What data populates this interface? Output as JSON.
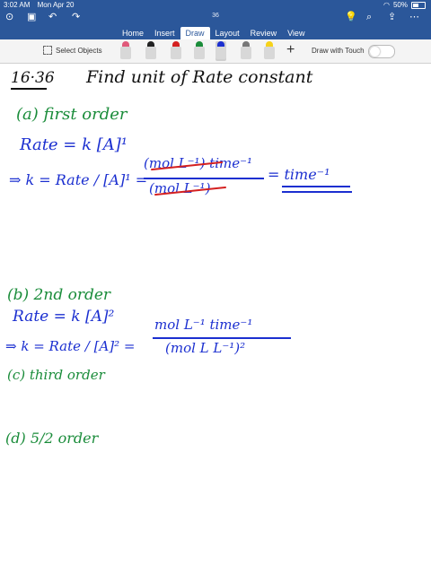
{
  "status_bar": {
    "time": "3:02 AM",
    "date": "Mon Apr 20",
    "battery": "50%",
    "battery_level": 0.5
  },
  "doc": {
    "title": "36"
  },
  "tabs": [
    "Home",
    "Insert",
    "Draw",
    "Layout",
    "Review",
    "View"
  ],
  "active_tab": "Draw",
  "toolbar": {
    "select_objects": "Select Objects",
    "draw_with_touch": "Draw with Touch",
    "pens": [
      {
        "name": "pen-pink",
        "color": "#e05a7a"
      },
      {
        "name": "pen-dark",
        "color": "#222222"
      },
      {
        "name": "pen-red",
        "color": "#d42020"
      },
      {
        "name": "pen-green",
        "color": "#1a8c3a"
      },
      {
        "name": "pen-blue",
        "color": "#1b2fd0"
      },
      {
        "name": "pencil-gray",
        "color": "#777777"
      },
      {
        "name": "highlighter-yellow",
        "color": "#f6d21a"
      }
    ]
  },
  "notes": {
    "heading_num": "16·36",
    "heading": "Find unit of Rate constant",
    "a_label": "(a) first order",
    "a_eq1": "Rate = k [A]¹",
    "a_eq2_lhs": "⇒ k = Rate / [A]¹ =",
    "a_num": "(mol L⁻¹) time⁻¹",
    "a_den": "(mol L⁻¹)",
    "a_result": "= time⁻¹",
    "b_label": "(b) 2nd order",
    "b_eq1": "Rate = k [A]²",
    "b_eq2_lhs": "⇒ k = Rate / [A]² =",
    "b_num": "mol L⁻¹ time⁻¹",
    "b_den": "(mol L L⁻¹)²",
    "c_label": "(c) third order",
    "d_label": "(d) 5/2 order"
  },
  "colors": {
    "ribbon": "#2b579a",
    "ink_green": "#1a8c3a",
    "ink_blue": "#1b2fd0",
    "ink_red": "#d42020"
  }
}
